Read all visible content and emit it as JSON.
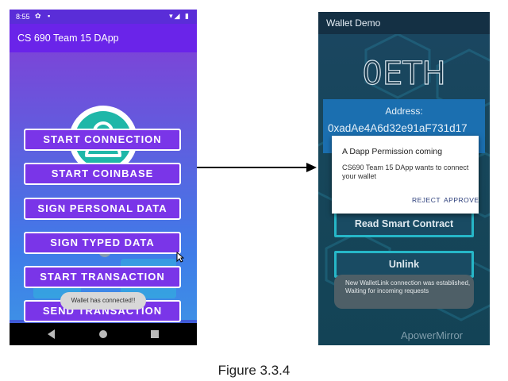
{
  "left_phone": {
    "status_bar": {
      "time": "8:55",
      "left_icons": "✿ ▪",
      "right_icons": "▾◢ ▮"
    },
    "app_title": "CS 690 Team 15 DApp",
    "buttons": [
      "START CONNECTION",
      "START COINBASE",
      "SIGN PERSONAL DATA",
      "SIGN TYPED DATA",
      "START TRANSACTION",
      "SEND TRANSACTION"
    ],
    "toast": "Wallet has connected!!"
  },
  "right_phone": {
    "title": "Wallet Demo",
    "balance": "0ETH",
    "address_label": "Address:",
    "address_value": "0xadAe4A6d32e91aF731d17",
    "dialog": {
      "title": "A Dapp Permission coming",
      "message": "CS690 Team 15 DApp wants to connect your wallet",
      "reject": "REJECT",
      "approve": "APPROVE"
    },
    "buttons": {
      "read_contract": "Read Smart Contract",
      "unlink": "Unlink"
    },
    "toast": "New WalletLink connection was established, Waiting for incoming requests",
    "watermark": "ApowerMirror"
  },
  "caption": "Figure 3.3.4",
  "colors": {
    "left_appbar": "#6a24e9",
    "left_button": "#7a35e8",
    "avatar": "#1fb7a8",
    "right_bg": "#17465a",
    "right_panel": "#1b6fb0",
    "right_button_border": "#26b7c8",
    "dialog_action": "#2a3d7a"
  }
}
